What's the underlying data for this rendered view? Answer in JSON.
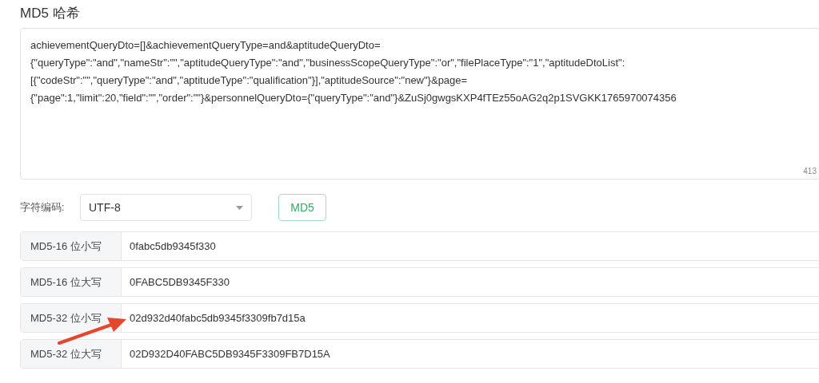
{
  "title": "MD5 哈希",
  "input": {
    "lines": [
      "achievementQueryDto=[]&achievementQueryType=and&aptitudeQueryDto=",
      "{\"queryType\":\"and\",\"nameStr\":\"\",\"aptitudeQueryType\":\"and\",\"businessScopeQueryType\":\"or\",\"filePlaceType\":\"1\",\"aptitudeDtoList\":",
      "[{\"codeStr\":\"\",\"queryType\":\"and\",\"aptitudeType\":\"qualification\"}],\"aptitudeSource\":\"new\"}&page=",
      "{\"page\":1,\"limit\":20,\"field\":\"\",\"order\":\"\"}&personnelQueryDto={\"queryType\":\"and\"}&ZuSj0gwgsKXP4fTEz55oAG2q2p1SVGKK1765970074356"
    ],
    "count": "413"
  },
  "encoding": {
    "label": "字符编码:",
    "value": "UTF-8"
  },
  "button": "MD5",
  "results": [
    {
      "label": "MD5-16 位小写",
      "value": "0fabc5db9345f330"
    },
    {
      "label": "MD5-16 位大写",
      "value": "0FABC5DB9345F330"
    },
    {
      "label": "MD5-32 位小写",
      "value": "02d932d40fabc5db9345f3309fb7d15a"
    },
    {
      "label": "MD5-32 位大写",
      "value": "02D932D40FABC5DB9345F3309FB7D15A"
    }
  ]
}
